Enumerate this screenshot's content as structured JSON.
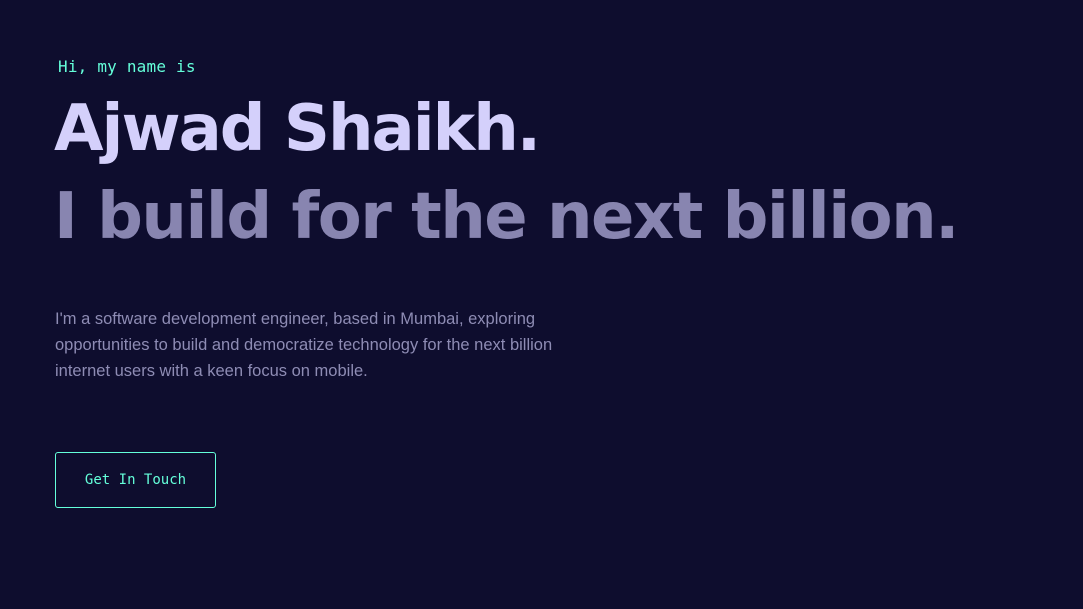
{
  "hero": {
    "greeting": "Hi, my name is",
    "name": "Ajwad Shaikh.",
    "tagline": "I build for the next billion.",
    "bio": "I'm a software development engineer, based in Mumbai, exploring opportunities to build and democratize technology for the next billion internet users with a keen focus on mobile.",
    "cta_label": "Get In Touch"
  },
  "colors": {
    "background": "#0e0d2e",
    "accent": "#64ffda",
    "name": "#d4d0fb",
    "tagline": "#8885b0",
    "body_text": "#8e8cb4"
  }
}
